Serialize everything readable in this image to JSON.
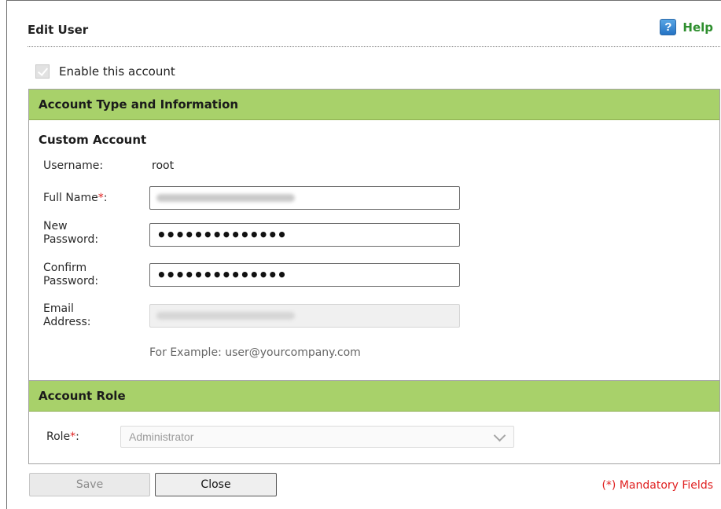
{
  "dialog": {
    "title": "Edit User",
    "help_label": "Help",
    "help_icon": "question-icon"
  },
  "enable_account": {
    "label": "Enable this account",
    "checked": true,
    "disabled": true
  },
  "account_info": {
    "header": "Account Type and Information",
    "subheading": "Custom Account",
    "username_label": "Username:",
    "username_value": "root",
    "full_name_label": "Full Name",
    "new_password_label_1": "New",
    "new_password_label_2": "Password:",
    "new_password_value": "••••••••••••••",
    "confirm_password_label_1": "Confirm",
    "confirm_password_label_2": "Password:",
    "confirm_password_value": "••••••••••••••",
    "email_label_1": "Email",
    "email_label_2": "Address:",
    "email_hint": "For Example: user@yourcompany.com"
  },
  "account_role": {
    "header": "Account Role",
    "role_label": "Role",
    "role_value": "Administrator"
  },
  "common": {
    "required_marker": "*",
    "colon": ":"
  },
  "footer": {
    "save_label": "Save",
    "close_label": "Close",
    "mandatory_note": "(*) Mandatory Fields"
  },
  "colors": {
    "section_header": "#a8d16a",
    "required": "#e02020",
    "help": "#2f8f2f"
  }
}
